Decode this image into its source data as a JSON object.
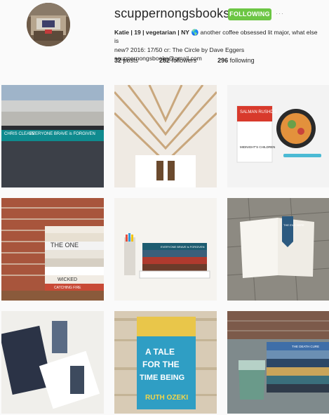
{
  "profile": {
    "username": "scuppernongsbooks",
    "follow_label": "FOLLOWING",
    "more_label": "···",
    "bio_name": "Katie | 19 | vegetarian | NY",
    "bio_line1_rest": "another coffee obsessed lit major, what else is",
    "bio_line2": "new? 2016: 17/50 cr: The Circle by Dave Eggers",
    "bio_email": "scuppernongsbooks@gmail.com"
  },
  "stats": {
    "posts_count": "32",
    "posts_label": "posts",
    "followers_count": "282",
    "followers_label": "followers",
    "following_count": "296",
    "following_label": "following"
  },
  "posts": [
    {
      "book_author": "CHRIS CLEAVE",
      "book_title": "EVERYONE BRAVE is FORGIVEN"
    },
    {
      "book_author": "",
      "book_title": ""
    },
    {
      "book_author": "SALMAN RUSHDIE",
      "book_title": "MIDNIGHT'S CHILDREN"
    },
    {
      "book_author": "",
      "book_title": "THE ONE"
    },
    {
      "book_author": "",
      "book_title": "EVERYONE BRAVE is FORGIVEN"
    },
    {
      "book_author": "",
      "book_title": "THE END HERE"
    },
    {
      "book_author": "",
      "book_title": ""
    },
    {
      "book_author": "RUTH OZEKI",
      "book_title": "A TALE FOR THE TIME BEING"
    },
    {
      "book_author": "",
      "book_title": "THE DEATH CURE"
    }
  ],
  "extra_labels": {
    "wicked": "WICKED",
    "catching_fire": "CATCHING FIRE",
    "a_tale": "A TALE",
    "for_the": "FOR THE",
    "time_being": "TIME BEING"
  },
  "colors": {
    "follow_green": "#6cc644",
    "background": "#fafafa"
  }
}
